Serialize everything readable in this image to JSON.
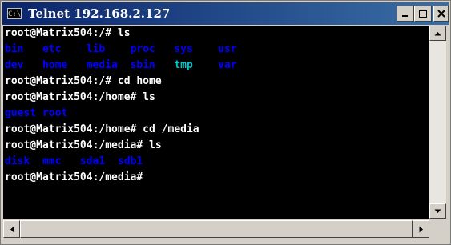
{
  "window": {
    "title": "Telnet 192.168.2.127",
    "app_icon_text": "C:\\",
    "icons": {
      "app": "console-app-icon",
      "minimize": "minimize-icon",
      "maximize": "maximize-icon",
      "close": "close-icon"
    }
  },
  "terminal": {
    "colors": {
      "background": "#000000",
      "prompt": "#ffffff",
      "directory": "#0000ff",
      "highlight": "#00c8c8"
    },
    "lines": [
      {
        "kind": "cmd",
        "text": "root@Matrix504:/# ls"
      },
      {
        "kind": "dirs",
        "items": [
          {
            "name": "bin",
            "col": 0
          },
          {
            "name": "etc",
            "col": 6
          },
          {
            "name": "lib",
            "col": 13
          },
          {
            "name": "proc",
            "col": 20
          },
          {
            "name": "sys",
            "col": 27
          },
          {
            "name": "usr",
            "col": 34
          }
        ]
      },
      {
        "kind": "dirs",
        "items": [
          {
            "name": "dev",
            "col": 0
          },
          {
            "name": "home",
            "col": 6
          },
          {
            "name": "media",
            "col": 13
          },
          {
            "name": "sbin",
            "col": 20
          },
          {
            "name": "tmp",
            "col": 27,
            "highlight": true
          },
          {
            "name": "var",
            "col": 34
          }
        ]
      },
      {
        "kind": "cmd",
        "text": "root@Matrix504:/# cd home"
      },
      {
        "kind": "cmd",
        "text": "root@Matrix504:/home# ls"
      },
      {
        "kind": "dirs",
        "items": [
          {
            "name": "guest",
            "col": 0
          },
          {
            "name": "root",
            "col": 6
          }
        ]
      },
      {
        "kind": "cmd",
        "text": "root@Matrix504:/home# cd /media"
      },
      {
        "kind": "cmd",
        "text": "root@Matrix504:/media# ls"
      },
      {
        "kind": "dirs",
        "items": [
          {
            "name": "disk",
            "col": 0
          },
          {
            "name": "mmc",
            "col": 6
          },
          {
            "name": "sda1",
            "col": 12
          },
          {
            "name": "sdb1",
            "col": 18
          }
        ]
      },
      {
        "kind": "cmd",
        "text": "root@Matrix504:/media#"
      }
    ]
  },
  "scrollbars": {
    "icons": {
      "up": "scroll-up-arrow-icon",
      "down": "scroll-down-arrow-icon",
      "left": "scroll-left-arrow-icon",
      "right": "scroll-right-arrow-icon"
    }
  }
}
